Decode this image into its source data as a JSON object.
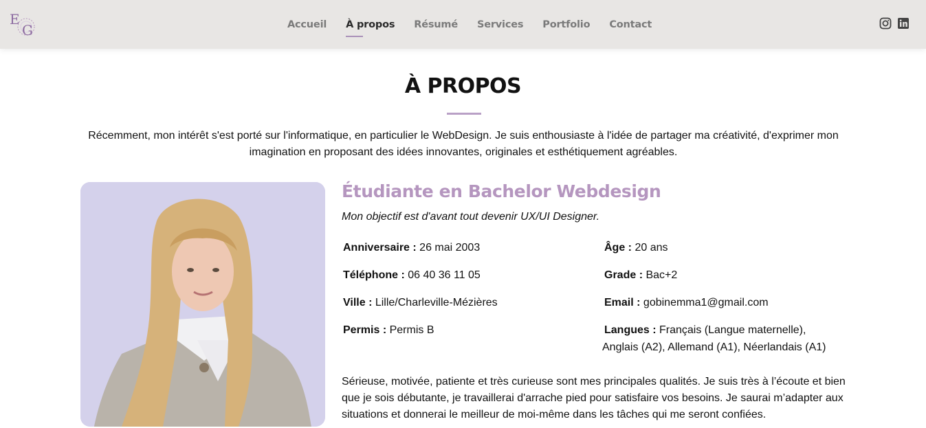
{
  "nav": {
    "items": [
      {
        "label": "Accueil",
        "active": false
      },
      {
        "label": "À propos",
        "active": true
      },
      {
        "label": "Résumé",
        "active": false
      },
      {
        "label": "Services",
        "active": false
      },
      {
        "label": "Portfolio",
        "active": false
      },
      {
        "label": "Contact",
        "active": false
      }
    ],
    "social": [
      "instagram-icon",
      "linkedin-icon"
    ]
  },
  "logo": {
    "text": "EG",
    "color": "#8c6aa0"
  },
  "about": {
    "title": "À PROPOS",
    "intro": "Récemment, mon intérêt s'est porté sur l'informatique, en particulier le WebDesign. Je suis enthousiaste à l'idée de partager ma créativité, d'exprimer mon imagination en proposant des idées innovantes, originales et esthétiquement agréables.",
    "role": "Étudiante en Bachelor Webdesign",
    "objective": "Mon objectif est d'avant tout devenir UX/UI Designer.",
    "left": [
      {
        "label": "Anniversaire :",
        "value": " 26 mai 2003"
      },
      {
        "label": "Téléphone :",
        "value": " 06 40 36 11 05"
      },
      {
        "label": "Ville :",
        "value": " Lille/Charleville-Mézières"
      },
      {
        "label": "Permis :",
        "value": " Permis B"
      }
    ],
    "right": [
      {
        "label": "Âge :",
        "value": " 20 ans"
      },
      {
        "label": "Grade :",
        "value": " Bac+2"
      },
      {
        "label": "Email :",
        "value": " gobinemma1@gmail.com"
      },
      {
        "label": "Langues :",
        "value": " Français (Langue maternelle),",
        "value2": "Anglais (A2), Allemand (A1), Néerlandais (A1)"
      }
    ],
    "bio": "Sérieuse, motivée, patiente et très curieuse sont mes principales qualités. Je suis très à l’écoute et bien que je sois débutante, je travaillerai d'arrache pied pour satisfaire vos besoins. Je saurai m’adapter aux situations et donnerai le meilleur de moi-même dans les tâches qui me seront confiées."
  },
  "colors": {
    "accent": "#b596bf",
    "topbar": "#e8e6e4",
    "photo_bg": "#d4d1eb"
  }
}
